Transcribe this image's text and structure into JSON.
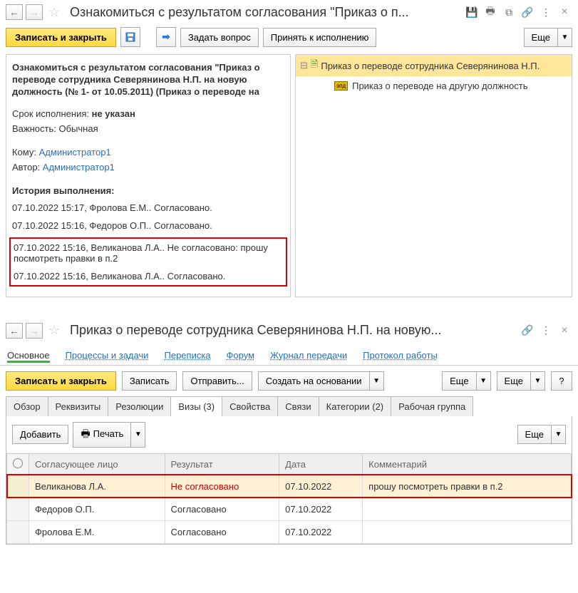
{
  "window1": {
    "title": "Ознакомиться с результатом согласования \"Приказ о п...",
    "toolbar": {
      "save_close": "Записать и закрыть",
      "ask_question": "Задать вопрос",
      "accept_execute": "Принять к исполнению",
      "more": "Еще"
    },
    "left": {
      "title": "Ознакомиться с результатом согласования \"Приказ о переводе сотрудника Северянинова Н.П. на новую должность (№ 1- от 10.05.2011) (Приказ о переводе на",
      "deadline_label": "Срок исполнения:",
      "deadline_value": "не указан",
      "importance_label": "Важность:",
      "importance_value": "Обычная",
      "to_label": "Кому:",
      "to_value": "Администратор1",
      "author_label": "Автор:",
      "author_value": "Администратор1",
      "history_label": "История выполнения:",
      "history": [
        "07.10.2022 15:17, Фролова Е.М.. Согласовано.",
        "07.10.2022 15:16, Федоров О.П.. Согласовано.",
        "07.10.2022 15:16, Великанова Л.А.. Не согласовано: прошу посмотреть правки в п.2",
        "07.10.2022 15:16, Великанова Л.А.. Согласовано."
      ]
    },
    "right": {
      "header": "Приказ о переводе сотрудника Северянинова Н.П.",
      "sub": "Приказ о переводе на другую должность"
    }
  },
  "window2": {
    "title": "Приказ о переводе сотрудника Северянинова Н.П. на новую...",
    "nav_tabs": [
      "Основное",
      "Процессы и задачи",
      "Переписка",
      "Форум",
      "Журнал передачи",
      "Протокол работы"
    ],
    "toolbar": {
      "save_close": "Записать и закрыть",
      "save": "Записать",
      "send": "Отправить...",
      "create_based": "Создать на основании",
      "more": "Еще",
      "help": "?"
    },
    "subtabs": [
      "Обзор",
      "Реквизиты",
      "Резолюции",
      "Визы (3)",
      "Свойства",
      "Связи",
      "Категории (2)",
      "Рабочая группа"
    ],
    "toolbar3": {
      "add": "Добавить",
      "print": "Печать",
      "more": "Еще"
    },
    "table": {
      "headers": [
        "Согласующее лицо",
        "Результат",
        "Дата",
        "Комментарий"
      ],
      "rows": [
        {
          "person": "Великанова Л.А.",
          "result": "Не согласовано",
          "date": "07.10.2022",
          "comment": "прошу посмотреть правки в п.2",
          "highlight": true
        },
        {
          "person": "Федоров О.П.",
          "result": "Согласовано",
          "date": "07.10.2022",
          "comment": ""
        },
        {
          "person": "Фролова Е.М.",
          "result": "Согласовано",
          "date": "07.10.2022",
          "comment": ""
        }
      ]
    }
  }
}
